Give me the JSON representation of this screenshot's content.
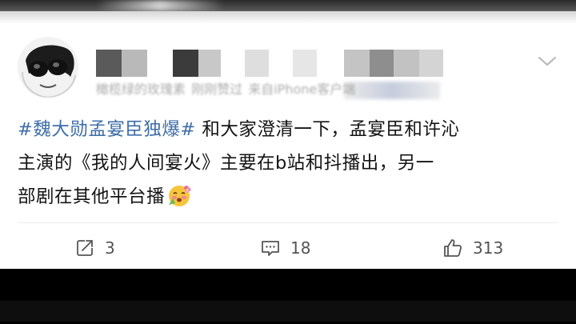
{
  "post": {
    "author_meta_blurred": {
      "name_part": "橄榄绿的玫瑰素",
      "time_part": "刚刚赞过",
      "source_part": "来自iPhone客户端"
    },
    "content": {
      "hashtag": "#魏大勋孟宴臣独爆#",
      "line1_rest": " 和大家澄清一下，孟宴臣和许沁",
      "line2": "主演的《我的人间宴火》主要在b站和抖播出，另一",
      "line3": "部剧在其他平台播"
    },
    "emoji_icon": "blushing-face-with-flower-emoji",
    "actions": {
      "repost_count": "3",
      "comment_count": "18",
      "like_count": "313"
    }
  },
  "colors": {
    "hashtag": "#3f6ea8",
    "text": "#141414",
    "meta": "#9e9e9e",
    "action": "#545454"
  },
  "icons": [
    "avatar-image",
    "chevron-down-icon",
    "repost-icon",
    "comment-icon",
    "like-icon"
  ]
}
